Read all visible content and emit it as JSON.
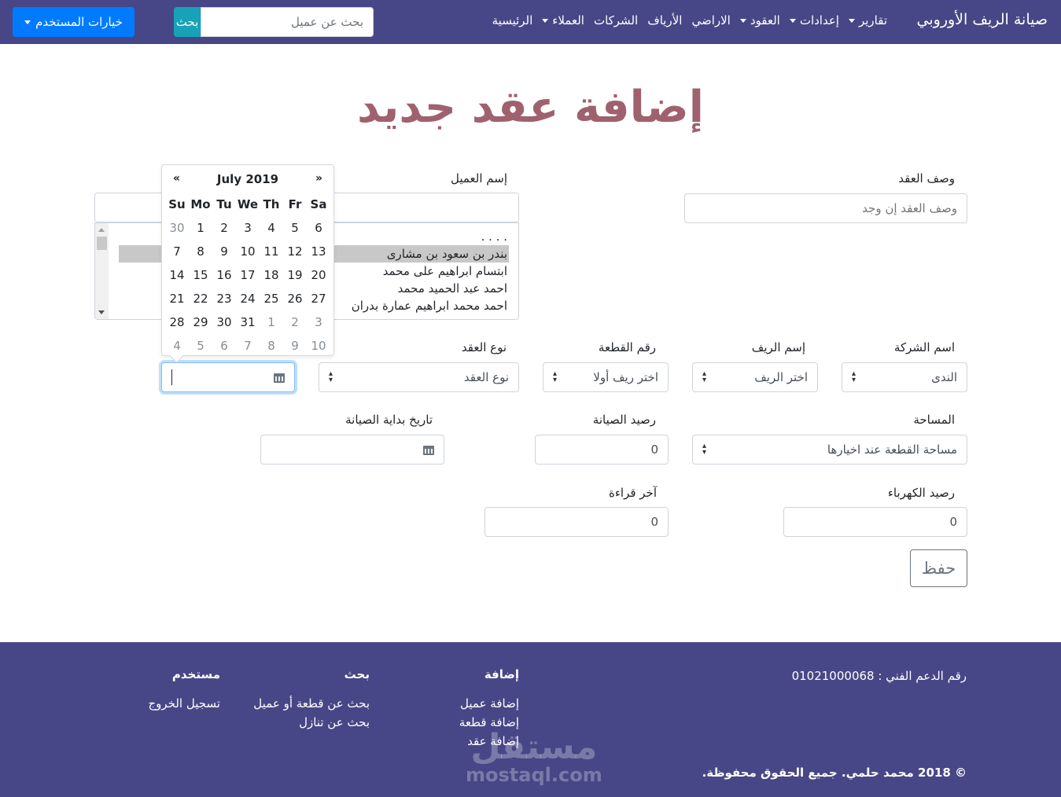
{
  "navbar": {
    "brand": "صيانة الريف الأوروبي",
    "items": [
      {
        "label": "الرئيسية",
        "dropdown": false
      },
      {
        "label": "العملاء",
        "dropdown": true
      },
      {
        "label": "الشركات",
        "dropdown": false
      },
      {
        "label": "الأرياف",
        "dropdown": false
      },
      {
        "label": "الاراضي",
        "dropdown": false
      },
      {
        "label": "العقود",
        "dropdown": true
      },
      {
        "label": "إعدادات",
        "dropdown": true
      },
      {
        "label": "تقارير",
        "dropdown": true
      }
    ],
    "search": {
      "placeholder": "بحث عن عميل",
      "value": "",
      "button_label": "بحث"
    },
    "user_menu_label": "خيارات المستخدم"
  },
  "page": {
    "title": "إضافة عقد جديد"
  },
  "form": {
    "contract_description": {
      "label": "وصف العقد",
      "placeholder": "وصف العقد إن وجد",
      "value": ""
    },
    "client_name": {
      "label": "إسم العميل",
      "value": "",
      "options": [
        ". . . .",
        "بندر بن سعود بن مشارى",
        "ابتسام ابراهيم على محمد",
        "احمد عبد الحميد محمد",
        "احمد محمد ابراهيم عمارة بدران"
      ],
      "selected_index": 1
    },
    "company_name": {
      "label": "اسم الشركة",
      "value": "الندى"
    },
    "countryside_name": {
      "label": "إسم الريف",
      "value": "اختر الريف"
    },
    "plot_number": {
      "label": "رقم القطعة",
      "value": "اختر ريف أولا"
    },
    "contract_type": {
      "label": "نوع العقد",
      "value": "نوع العقد"
    },
    "contract_date": {
      "label": "",
      "value": ""
    },
    "area": {
      "label": "المساحة",
      "value": "مساحة القطعة عند اخيارها"
    },
    "maintenance_balance": {
      "label": "رصيد الصيانة",
      "value": "0"
    },
    "maintenance_start_date": {
      "label": "تاريخ بداية الصيانة",
      "value": ""
    },
    "electricity_balance": {
      "label": "رصيد الكهرباء",
      "value": "0"
    },
    "last_reading": {
      "label": "آخر قراءة",
      "value": "0"
    },
    "save_label": "حفظ"
  },
  "datepicker": {
    "title": "July 2019",
    "prev": "«",
    "next": "»",
    "weekdays": [
      "Su",
      "Mo",
      "Tu",
      "We",
      "Th",
      "Fr",
      "Sa"
    ],
    "days": [
      {
        "d": "30",
        "muted": true
      },
      {
        "d": "1"
      },
      {
        "d": "2"
      },
      {
        "d": "3"
      },
      {
        "d": "4"
      },
      {
        "d": "5"
      },
      {
        "d": "6"
      },
      {
        "d": "7"
      },
      {
        "d": "8"
      },
      {
        "d": "9"
      },
      {
        "d": "10"
      },
      {
        "d": "11"
      },
      {
        "d": "12"
      },
      {
        "d": "13"
      },
      {
        "d": "14"
      },
      {
        "d": "15"
      },
      {
        "d": "16"
      },
      {
        "d": "17"
      },
      {
        "d": "18"
      },
      {
        "d": "19"
      },
      {
        "d": "20"
      },
      {
        "d": "21"
      },
      {
        "d": "22"
      },
      {
        "d": "23"
      },
      {
        "d": "24"
      },
      {
        "d": "25"
      },
      {
        "d": "26"
      },
      {
        "d": "27"
      },
      {
        "d": "28"
      },
      {
        "d": "29"
      },
      {
        "d": "30"
      },
      {
        "d": "31"
      },
      {
        "d": "1",
        "muted": true
      },
      {
        "d": "2",
        "muted": true
      },
      {
        "d": "3",
        "muted": true
      },
      {
        "d": "4",
        "muted": true
      },
      {
        "d": "5",
        "muted": true
      },
      {
        "d": "6",
        "muted": true
      },
      {
        "d": "7",
        "muted": true
      },
      {
        "d": "8",
        "muted": true
      },
      {
        "d": "9",
        "muted": true
      },
      {
        "d": "10",
        "muted": true
      }
    ]
  },
  "footer": {
    "support": "رقم الدعم الفني : 01021000068",
    "copyright": "© 2018 محمد حلمي. جميع الحقوق محفوظة.",
    "columns": [
      {
        "heading": "إضافة",
        "links": [
          "إضافة عميل",
          "إضافة قطعة",
          "إضافة عقد"
        ]
      },
      {
        "heading": "بحث",
        "links": [
          "بحث عن قطعة أو عميل",
          "بحث عن تنازل"
        ]
      },
      {
        "heading": "مستخدم",
        "links": [
          "تسجيل الخروج"
        ]
      }
    ],
    "watermark": {
      "arabic": "مستقل",
      "latin": "mostaql.com"
    }
  },
  "colors": {
    "navbar": "#474787",
    "title": "#a0616f",
    "search_button": "#17a2b8",
    "user_button": "#007bff",
    "save_outline": "#6c757d"
  }
}
